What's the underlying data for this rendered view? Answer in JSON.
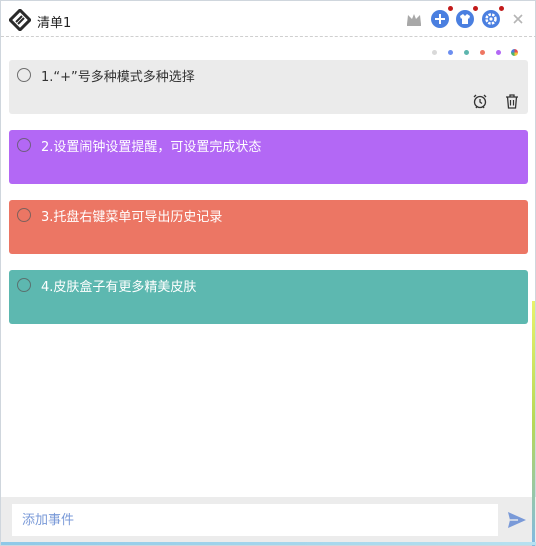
{
  "window": {
    "title": "清单1"
  },
  "header": {
    "icons": [
      "crown-icon",
      "add-icon",
      "skin-icon",
      "settings-icon",
      "close-icon"
    ],
    "accent": "#4a7fe0"
  },
  "palette": [
    "#d9d9d9",
    "#6c8ef0",
    "#5db5ae",
    "#ee7662",
    "#b368f5",
    "multicolor"
  ],
  "tasks": [
    {
      "text": "1.“+”号多种模式多种选择",
      "color": "#ebebeb",
      "text_color": "#333333"
    },
    {
      "text": "2.设置闹钟设置提醒，可设置完成状态",
      "color": "#b368f5",
      "text_color": "#ffffff"
    },
    {
      "text": "3.托盘右键菜单可导出历史记录",
      "color": "#ec7664",
      "text_color": "#ffffff"
    },
    {
      "text": "4.皮肤盒子有更多精美皮肤",
      "color": "#5db8b0",
      "text_color": "#ffffff"
    }
  ],
  "card_actions": [
    "alarm-clock-icon",
    "trash-icon"
  ],
  "add_bar": {
    "placeholder": "添加事件"
  }
}
